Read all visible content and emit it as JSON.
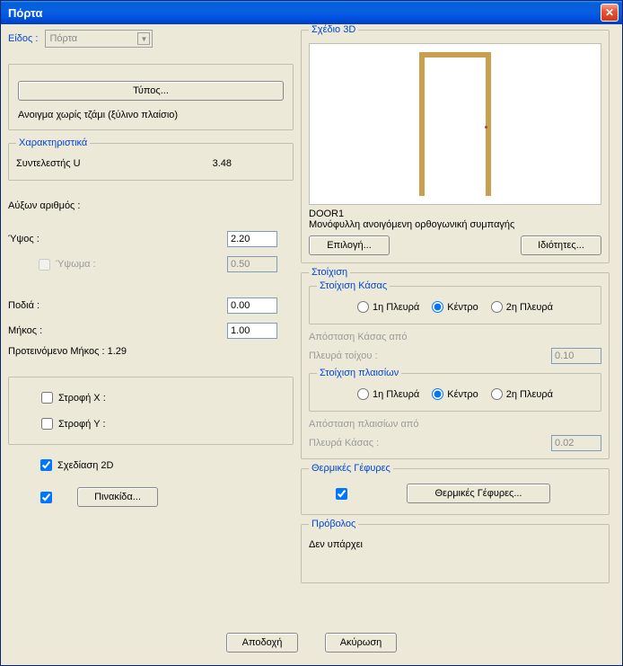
{
  "window": {
    "title": "Πόρτα"
  },
  "kind": {
    "label": "Είδος :",
    "value": "Πόρτα"
  },
  "type_button": "Τύπος...",
  "type_desc": "Ανοιγμα χωρίς τζάμι (ξύλινο πλαίσιο)",
  "chars": {
    "legend": "Χαρακτηριστικά",
    "u_label": "Συντελεστής U",
    "u_value": "3.48"
  },
  "seq_label": "Αύξων αριθμός :",
  "height": {
    "label": "Ύψος :",
    "value": "2.20"
  },
  "rise": {
    "label": "Ύψωμα :",
    "value": "0.50"
  },
  "sill": {
    "label": "Ποδιά :",
    "value": "0.00"
  },
  "length": {
    "label": "Μήκος :",
    "value": "1.00"
  },
  "suggested": "Προτεινόμενο Μήκος : 1.29",
  "rotX": "Στροφή Χ :",
  "rotY": "Στροφή Y :",
  "draw2d": "Σχεδίαση 2D",
  "plate_btn": "Πινακίδα...",
  "preview3d": {
    "legend": "Σχέδιο 3D",
    "code": "DOOR1",
    "desc": "Μονόφυλλη ανοιγόμενη ορθογωνική συμπαγής",
    "select_btn": "Επιλογή...",
    "props_btn": "Ιδιότητες..."
  },
  "align": {
    "legend": "Στοίχιση",
    "frame_legend": "Στοίχιση Κάσας",
    "side1": "1η Πλευρά",
    "center": "Κέντρο",
    "side2": "2η Πλευρά",
    "frame_dist_label": "Απόσταση Κάσας από",
    "wall_side_label": "Πλευρά τοίχου :",
    "frame_dist_value": "0.10",
    "panel_legend": "Στοίχιση πλαισίων",
    "panel_dist_label": "Απόσταση πλαισίων από",
    "panel_side_label": "Πλευρά Κάσας :",
    "panel_dist_value": "0.02"
  },
  "thermal": {
    "legend": "Θερμικές Γέφυρες",
    "button": "Θερμικές Γέφυρες..."
  },
  "overhang": {
    "legend": "Πρόβολος",
    "text": "Δεν υπάρχει"
  },
  "buttons": {
    "ok": "Αποδοχή",
    "cancel": "Ακύρωση"
  }
}
